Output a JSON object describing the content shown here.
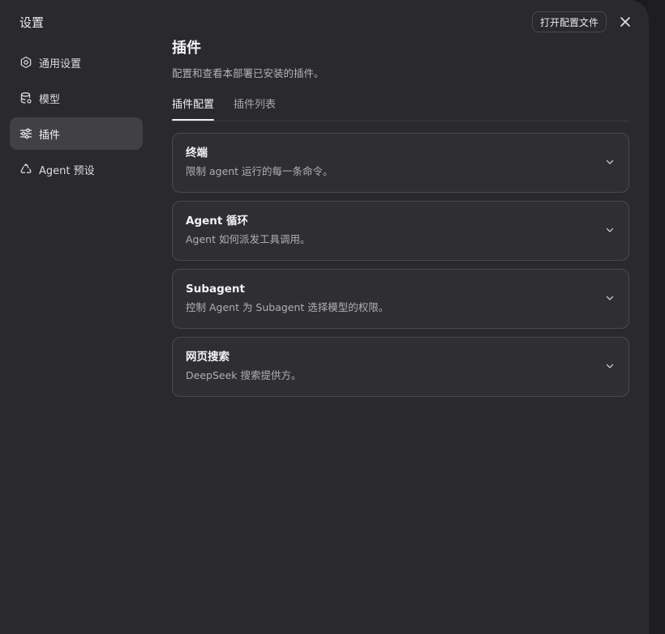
{
  "window": {
    "title": "设置",
    "open_config_label": "打开配置文件"
  },
  "sidebar": {
    "items": [
      {
        "label": "通用设置",
        "icon": "gear-icon",
        "active": false
      },
      {
        "label": "模型",
        "icon": "database-icon",
        "active": false
      },
      {
        "label": "插件",
        "icon": "sliders-icon",
        "active": true
      },
      {
        "label": "Agent 预设",
        "icon": "recycle-icon",
        "active": false
      }
    ]
  },
  "main": {
    "title": "插件",
    "subtitle": "配置和查看本部署已安装的插件。",
    "tabs": [
      {
        "label": "插件配置",
        "active": true
      },
      {
        "label": "插件列表",
        "active": false
      }
    ],
    "cards": [
      {
        "title": "终端",
        "description": "限制 agent 运行的每一条命令。"
      },
      {
        "title": "Agent 循环",
        "description": "Agent 如何派发工具调用。"
      },
      {
        "title": "Subagent",
        "description": "控制 Agent 为 Subagent 选择模型的权限。"
      },
      {
        "title": "网页搜索",
        "description": "DeepSeek 搜索提供方。"
      }
    ]
  },
  "colors": {
    "window_bg": "#2a2a2c",
    "card_bg": "#2f2f32",
    "active_item_bg": "#414145",
    "border": "#4a4a4e"
  }
}
